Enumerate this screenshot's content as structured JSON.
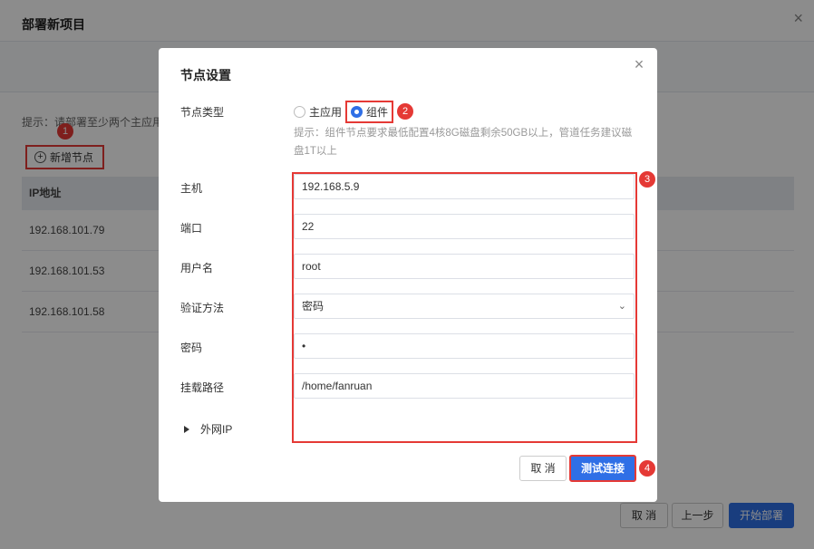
{
  "background": {
    "title": "部署新项目",
    "hint": "提示：请部署至少两个主应用",
    "add_node": "新增节点",
    "table": {
      "header": "IP地址",
      "rows": [
        "192.168.101.79",
        "192.168.101.53",
        "192.168.101.58"
      ]
    },
    "footer": {
      "cancel": "取 消",
      "prev": "上一步",
      "start": "开始部署"
    }
  },
  "modal": {
    "title": "节点设置",
    "close_icon": "×",
    "node_type_label": "节点类型",
    "node_type_options": [
      "主应用",
      "组件"
    ],
    "node_type_selected": "组件",
    "type_hint": "提示：组件节点要求最低配置4核8G磁盘剩余50GB以上，管道任务建议磁盘1T以上",
    "fields": {
      "host_label": "主机",
      "host_value": "192.168.5.9",
      "port_label": "端口",
      "port_value": "22",
      "user_label": "用户名",
      "user_value": "root",
      "auth_label": "验证方法",
      "auth_value": "密码",
      "password_label": "密码",
      "password_value": "•",
      "mount_label": "挂载路径",
      "mount_value": "/home/fanruan"
    },
    "external_ip": "外网IP",
    "cancel": "取 消",
    "test": "测试连接"
  },
  "annotations": [
    "1",
    "2",
    "3",
    "4"
  ],
  "colors": {
    "primary": "#2f6fe6",
    "highlight": "#e53935"
  }
}
